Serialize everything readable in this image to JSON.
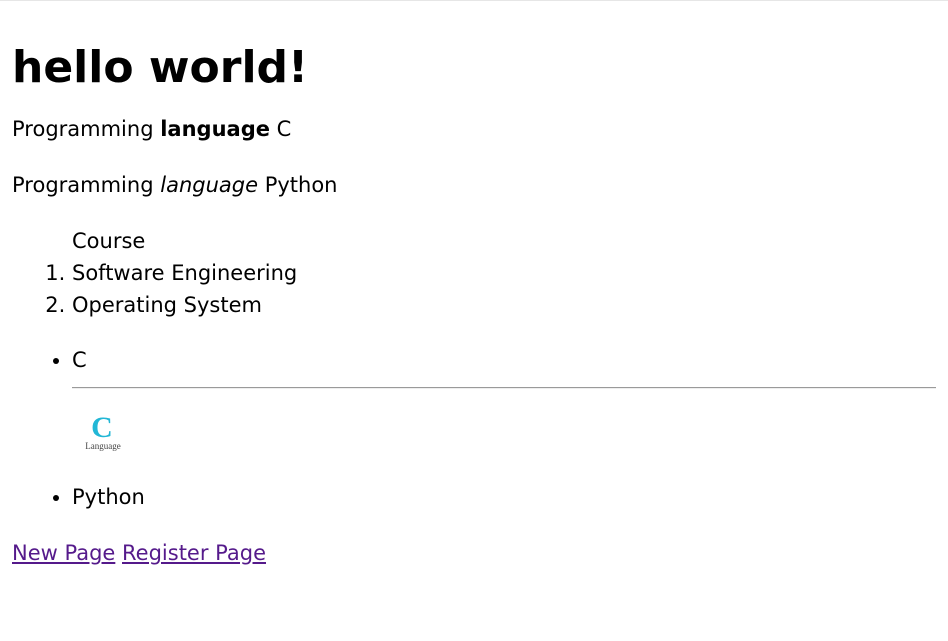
{
  "heading": "hello world!",
  "para1": {
    "prefix": "Programming",
    "bold": "language",
    "suffix": "C"
  },
  "para2": {
    "prefix": "Programming",
    "italic": "language",
    "suffix": "Python"
  },
  "course_list": {
    "caption": "Course",
    "items": [
      "Software Engineering",
      "Operating System"
    ]
  },
  "languages": {
    "items": [
      "C",
      "Python"
    ],
    "logo": {
      "letter": "C",
      "text": "Language",
      "accent": "#22b7d6"
    }
  },
  "links": [
    "New Page",
    "Register Page"
  ],
  "colors": {
    "link": "#551a8b",
    "text": "#000000"
  }
}
